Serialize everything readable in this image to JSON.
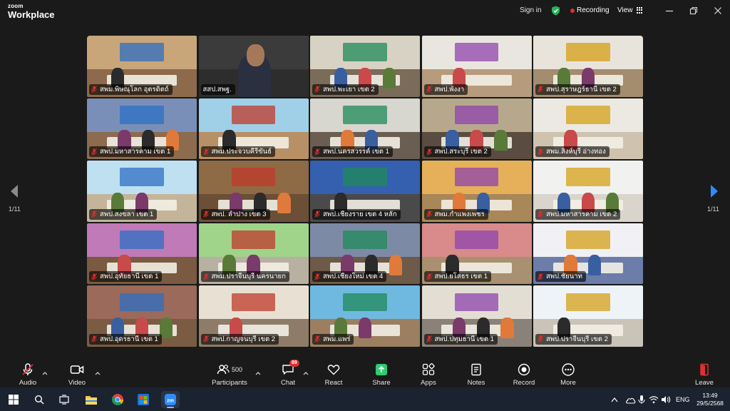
{
  "app": {
    "logo_small": "zoom",
    "logo_big": "Workplace"
  },
  "topbar": {
    "signin": "Sign in",
    "recording": "Recording",
    "view": "View"
  },
  "colors": {
    "background": "#1a1a1a",
    "active_speaker_border": "#2ecc71",
    "nav_arrow": "#2d8cff",
    "recording_dot": "#e02f2f",
    "share_green": "#2ecc71",
    "badge_red": "#e02f2f"
  },
  "gallery": {
    "page_left": "1/11",
    "page_right": "1/11",
    "tiles": [
      {
        "name": "สพม.พิษณุโลก อุตรดิตถ์",
        "muted": true,
        "active": false
      },
      {
        "name": "สสป.สพฐ.",
        "muted": false,
        "active": true
      },
      {
        "name": "สพป.พะเยา เขต 2",
        "muted": true,
        "active": false
      },
      {
        "name": "สพป.พังงา",
        "muted": true,
        "active": false
      },
      {
        "name": "สพป.สุราษฎร์ธานี เขต 2",
        "muted": true,
        "active": false
      },
      {
        "name": "สพป.มหาสารคาม เขต 1",
        "muted": true,
        "active": false
      },
      {
        "name": "สพม.ประจวบคีรีขันธ์",
        "muted": true,
        "active": false
      },
      {
        "name": "สพป.นครสวรรค์ เขต 1",
        "muted": true,
        "active": false
      },
      {
        "name": "สพป.สระบุรี เขต 2",
        "muted": true,
        "active": false
      },
      {
        "name": "สพม.สิงห์บุรี อ่างทอง",
        "muted": true,
        "active": false
      },
      {
        "name": "สพป.สงขลา เขต 1",
        "muted": true,
        "active": false
      },
      {
        "name": "สพป. ลำปาง เขต 3",
        "muted": true,
        "active": false
      },
      {
        "name": "สพป.เชียงราย เขต 4 หลัก",
        "muted": true,
        "active": false
      },
      {
        "name": "สพม.กำแพงเพชร",
        "muted": true,
        "active": false
      },
      {
        "name": "สพป.มหาสารคาม เขต 2",
        "muted": true,
        "active": false
      },
      {
        "name": "สพป.อุทัยธานี เขต 1",
        "muted": true,
        "active": false
      },
      {
        "name": "สพม.ปราจีนบุรี นครนายก",
        "muted": true,
        "active": false
      },
      {
        "name": "สพป.เชียงใหม่ เขต 4",
        "muted": true,
        "active": false
      },
      {
        "name": "สพป.ยโสธร เขต 1",
        "muted": true,
        "active": false
      },
      {
        "name": "สพป.ชัยนาท",
        "muted": true,
        "active": false
      },
      {
        "name": "สพป.อุดรธานี เขต 1",
        "muted": true,
        "active": false
      },
      {
        "name": "สพป.กาญจนบุรี เขต 2",
        "muted": true,
        "active": false
      },
      {
        "name": "สพม.แพร่",
        "muted": true,
        "active": false
      },
      {
        "name": "สพป.ปทุมธานี เขต 1",
        "muted": true,
        "active": false
      },
      {
        "name": "สพป.ปราจีนบุรี เขต 2",
        "muted": true,
        "active": false
      }
    ]
  },
  "toolbar": {
    "audio": "Audio",
    "video": "Video",
    "participants": "Participants",
    "participants_count": "500",
    "chat": "Chat",
    "chat_badge": "89",
    "react": "React",
    "share": "Share",
    "apps": "Apps",
    "notes": "Notes",
    "record": "Record",
    "more": "More",
    "leave": "Leave"
  },
  "taskbar": {
    "language": "ENG",
    "time": "13:49",
    "date": "29/5/2568"
  }
}
